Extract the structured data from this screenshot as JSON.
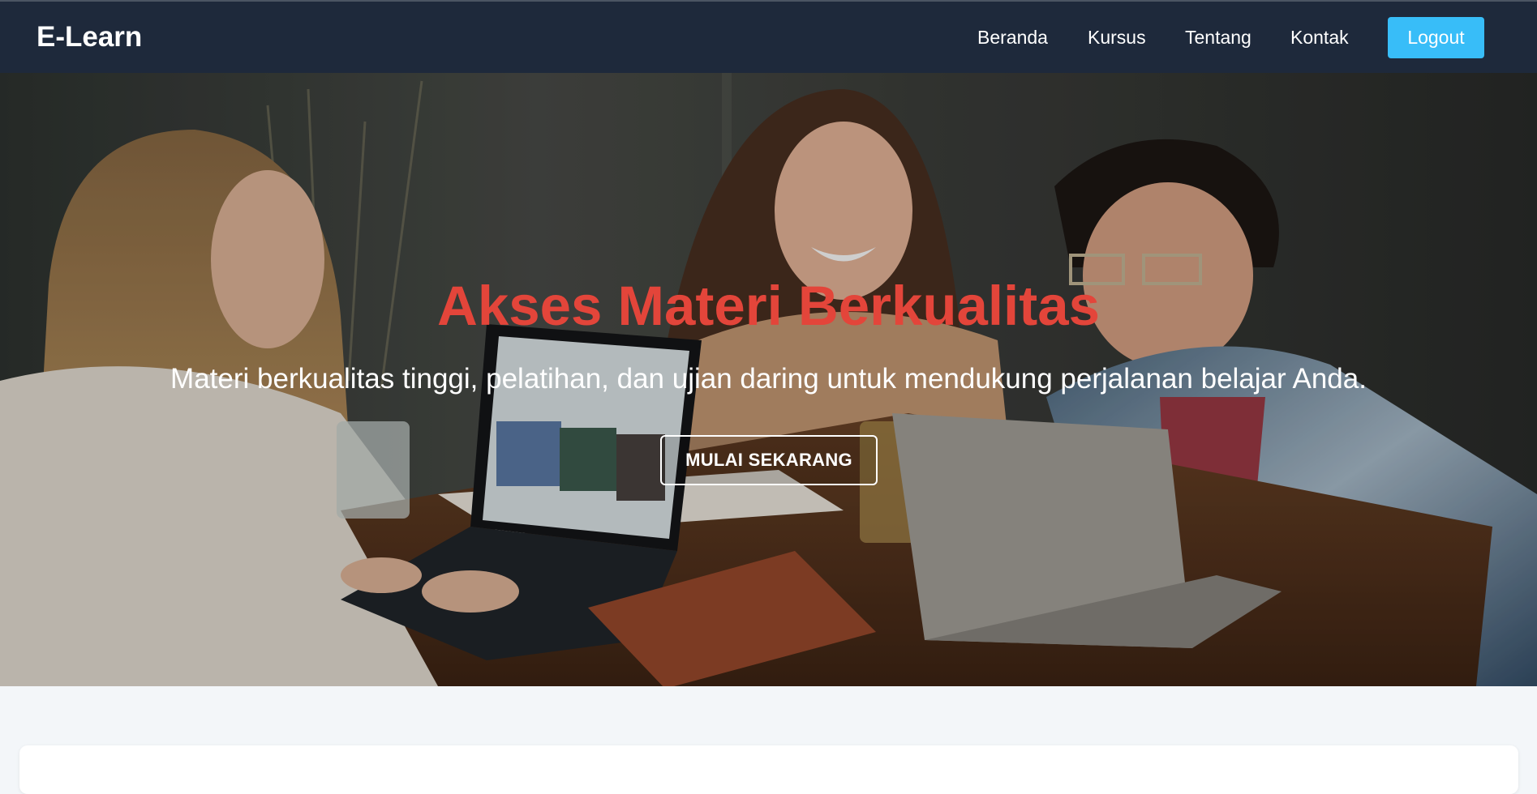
{
  "navbar": {
    "brand": "E-Learn",
    "links": [
      "Beranda",
      "Kursus",
      "Tentang",
      "Kontak"
    ],
    "logout_label": "Logout"
  },
  "hero": {
    "title": "Akses Materi Berkualitas",
    "subtitle": "Materi berkualitas tinggi, pelatihan, dan ujian daring untuk mendukung perjalanan belajar Anda.",
    "cta_label": "MULAI SEKARANG"
  },
  "colors": {
    "navbar_bg": "#1e293b",
    "accent": "#38bdf8",
    "title": "#e3453a",
    "page_bg": "#f3f6f9"
  }
}
